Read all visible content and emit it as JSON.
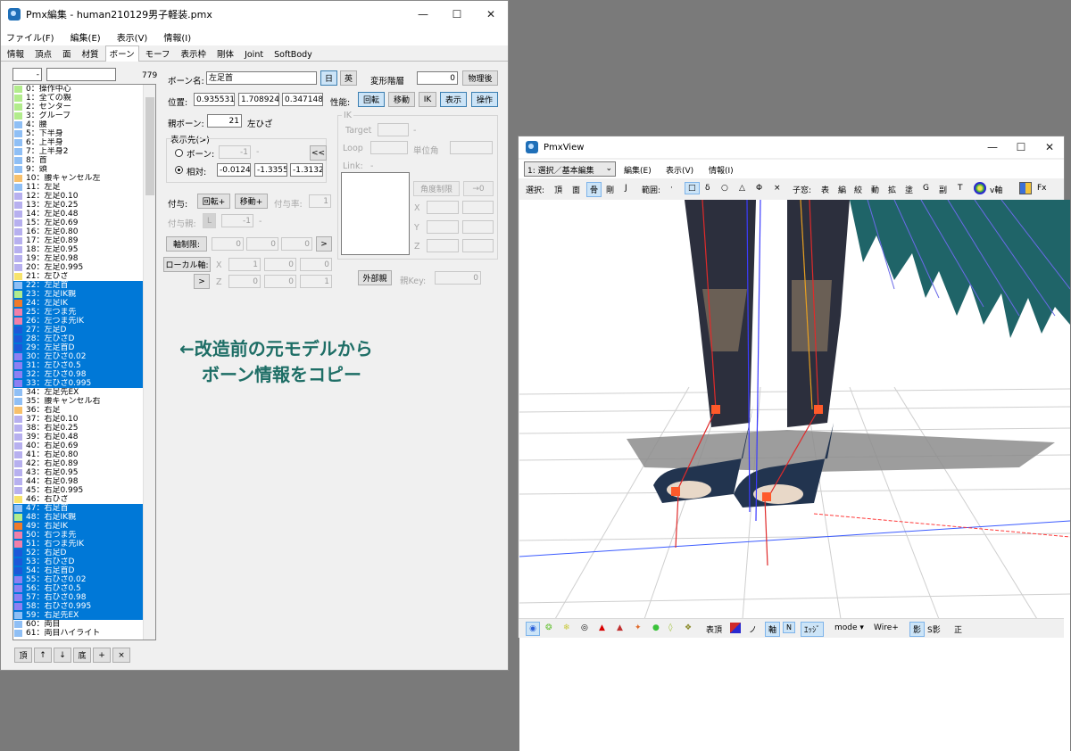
{
  "pmx_editor": {
    "title": "Pmx編集 - human210129男子軽装.pmx",
    "menu": [
      "ファイル(F)",
      "編集(E)",
      "表示(V)",
      "情報(I)"
    ],
    "tabs": [
      "情報",
      "頂点",
      "面",
      "材質",
      "ボーン",
      "モーフ",
      "表示枠",
      "剛体",
      "Joint",
      "SoftBody"
    ],
    "active_tab": "ボーン",
    "filter_value": "-",
    "bone_count": "779",
    "bone_name_label": "ボーン名:",
    "bone_name_value": "左足首",
    "lang_ja": "日",
    "lang_en": "英",
    "deform_label": "変形階層",
    "deform_value": "0",
    "after_physics": "物理後",
    "position_label": "位置:",
    "pos_x": "0.9355315",
    "pos_y": "1.708924",
    "pos_z": "0.3471485",
    "perf_label": "性能:",
    "rotate_btn": "回転",
    "move_btn": "移動",
    "ik_btn": "IK",
    "display_btn": "表示",
    "operate_btn": "操作",
    "parent_label": "親ボーン:",
    "parent_value": "21",
    "parent_name": "左ひざ",
    "dest_label": "表示先(>)",
    "radio_bone": "ボーン:",
    "radio_bone_value": "-1",
    "dash": "-",
    "radio_rel": "相対:",
    "rel_x": "-0.0124",
    "rel_y": "-1.3355",
    "rel_z": "-1.3132",
    "back_btn": "<<",
    "ik_group": "IK",
    "ik_target": "Target",
    "ik_loop": "Loop",
    "ik_unit_angle": "単位角",
    "ik_link": "Link:",
    "angle_limit": "角度制限",
    "arrow_zero": "→0",
    "x": "X",
    "y": "Y",
    "z": "Z",
    "grant_label": "付与:",
    "grant_rot": "回転+",
    "grant_move": "移動+",
    "grant_rate_label": "付与率:",
    "grant_rate": "1",
    "grant_parent_label": "付与親:",
    "grant_parent_l": "L",
    "grant_parent_value": "-1",
    "axis_limit": "軸制限:",
    "axis_v1": "0",
    "axis_v2": "0",
    "axis_v3": "0",
    "local_axis": "ローカル軸:",
    "local_x1": "1",
    "local_x2": "0",
    "local_x3": "0",
    "local_z1": "0",
    "local_z2": "0",
    "local_z3": "1",
    "ext_parent": "外部親",
    "parent_key": "親Key:",
    "parent_key_value": "0",
    "bottom_buttons": [
      "頂",
      "↑",
      "↓",
      "底",
      "+",
      "×"
    ],
    "bones": [
      {
        "t": "0：操作中心",
        "c": "#b2ec8c",
        "s": false
      },
      {
        "t": "1：全ての親",
        "c": "#b2ec8c",
        "s": false
      },
      {
        "t": "2：センター",
        "c": "#b2ec8c",
        "s": false
      },
      {
        "t": "3：グルーブ",
        "c": "#b2ec8c",
        "s": false
      },
      {
        "t": "4：腰",
        "c": "#8fbff5",
        "s": false
      },
      {
        "t": "5：下半身",
        "c": "#8fbff5",
        "s": false
      },
      {
        "t": "6：上半身",
        "c": "#8fbff5",
        "s": false
      },
      {
        "t": "7：上半身2",
        "c": "#8fbff5",
        "s": false
      },
      {
        "t": "8：首",
        "c": "#8fbff5",
        "s": false
      },
      {
        "t": "9：頭",
        "c": "#8fbff5",
        "s": false
      },
      {
        "t": "10：腰キャンセル左",
        "c": "#f7c06b",
        "s": false
      },
      {
        "t": "11：左足",
        "c": "#8fbff5",
        "s": false
      },
      {
        "t": "12：左足0.10",
        "c": "#b7b0ef",
        "s": false
      },
      {
        "t": "13：左足0.25",
        "c": "#b7b0ef",
        "s": false
      },
      {
        "t": "14：左足0.48",
        "c": "#b7b0ef",
        "s": false
      },
      {
        "t": "15：左足0.69",
        "c": "#b7b0ef",
        "s": false
      },
      {
        "t": "16：左足0.80",
        "c": "#b7b0ef",
        "s": false
      },
      {
        "t": "17：左足0.89",
        "c": "#b7b0ef",
        "s": false
      },
      {
        "t": "18：左足0.95",
        "c": "#b7b0ef",
        "s": false
      },
      {
        "t": "19：左足0.98",
        "c": "#b7b0ef",
        "s": false
      },
      {
        "t": "20：左足0.995",
        "c": "#b7b0ef",
        "s": false
      },
      {
        "t": "21：左ひざ",
        "c": "#f7e36b",
        "s": false
      },
      {
        "t": "22：左足首",
        "c": "#8fbff5",
        "s": true
      },
      {
        "t": "23：左足IK親",
        "c": "#b2ec8c",
        "s": true
      },
      {
        "t": "24：左足IK",
        "c": "#f07a2a",
        "s": true
      },
      {
        "t": "25：左つま先",
        "c": "#f27fa8",
        "s": true
      },
      {
        "t": "26：左つま先IK",
        "c": "#f27fa8",
        "s": true
      },
      {
        "t": "27：左足D",
        "c": "#1e58d8",
        "s": true
      },
      {
        "t": "28：左ひざD",
        "c": "#1e58d8",
        "s": true
      },
      {
        "t": "29：左足首D",
        "c": "#1e58d8",
        "s": true
      },
      {
        "t": "30：左ひざ0.02",
        "c": "#8d7ff2",
        "s": true
      },
      {
        "t": "31：左ひざ0.5",
        "c": "#8d7ff2",
        "s": true
      },
      {
        "t": "32：左ひざ0.98",
        "c": "#8d7ff2",
        "s": true
      },
      {
        "t": "33：左ひざ0.995",
        "c": "#8d7ff2",
        "s": true
      },
      {
        "t": "34：左足先EX",
        "c": "#8fbff5",
        "s": false
      },
      {
        "t": "35：腰キャンセル右",
        "c": "#8fbff5",
        "s": false
      },
      {
        "t": "36：右足",
        "c": "#f7c06b",
        "s": false
      },
      {
        "t": "37：右足0.10",
        "c": "#b7b0ef",
        "s": false
      },
      {
        "t": "38：右足0.25",
        "c": "#b7b0ef",
        "s": false
      },
      {
        "t": "39：右足0.48",
        "c": "#b7b0ef",
        "s": false
      },
      {
        "t": "40：右足0.69",
        "c": "#b7b0ef",
        "s": false
      },
      {
        "t": "41：右足0.80",
        "c": "#b7b0ef",
        "s": false
      },
      {
        "t": "42：右足0.89",
        "c": "#b7b0ef",
        "s": false
      },
      {
        "t": "43：右足0.95",
        "c": "#b7b0ef",
        "s": false
      },
      {
        "t": "44：右足0.98",
        "c": "#b7b0ef",
        "s": false
      },
      {
        "t": "45：右足0.995",
        "c": "#b7b0ef",
        "s": false
      },
      {
        "t": "46：右ひざ",
        "c": "#f7e36b",
        "s": false
      },
      {
        "t": "47：右足首",
        "c": "#8fbff5",
        "s": true
      },
      {
        "t": "48：右足IK親",
        "c": "#b2ec8c",
        "s": true
      },
      {
        "t": "49：右足IK",
        "c": "#f07a2a",
        "s": true
      },
      {
        "t": "50：右つま先",
        "c": "#f27fa8",
        "s": true
      },
      {
        "t": "51：右つま先IK",
        "c": "#f27fa8",
        "s": true
      },
      {
        "t": "52：右足D",
        "c": "#1e58d8",
        "s": true
      },
      {
        "t": "53：右ひざD",
        "c": "#1e58d8",
        "s": true
      },
      {
        "t": "54：右足首D",
        "c": "#1e58d8",
        "s": true
      },
      {
        "t": "55：右ひざ0.02",
        "c": "#8d7ff2",
        "s": true
      },
      {
        "t": "56：右ひざ0.5",
        "c": "#8d7ff2",
        "s": true
      },
      {
        "t": "57：右ひざ0.98",
        "c": "#8d7ff2",
        "s": true
      },
      {
        "t": "58：右ひざ0.995",
        "c": "#8d7ff2",
        "s": true
      },
      {
        "t": "59：右足先EX",
        "c": "#8fbff5",
        "s": true
      },
      {
        "t": "60：両目",
        "c": "#8fbff5",
        "s": false
      },
      {
        "t": "61：両目ハイライト",
        "c": "#8fbff5",
        "s": false
      }
    ]
  },
  "annotation": {
    "line1": "←改造前の元モデルから",
    "line2": "ボーン情報をコピー"
  },
  "pmx_view": {
    "title": "PmxView",
    "mode_select": "1: 選択／基本編集",
    "menu": [
      "編集(E)",
      "表示(V)",
      "情報(I)"
    ],
    "toolbar": {
      "select_label": "選択:",
      "select_items": [
        "頂",
        "面",
        "骨",
        "剛",
        "J"
      ],
      "range_label": "範囲:",
      "range_items": [
        "·",
        "□",
        "δ",
        "○",
        "△",
        "Φ",
        "×"
      ],
      "child_label": "子窓:",
      "child_items": [
        "表",
        "編",
        "絞",
        "動",
        "拡",
        "塗",
        "G",
        "副",
        "T"
      ],
      "vaxis": "v軸",
      "fx": "Fx"
    },
    "bottom": {
      "table_top": "表頂",
      "no": "ノ",
      "axis": "軸",
      "edge": "ｴｯｼﾞ",
      "mode": "mode ▾",
      "wire": "Wire+",
      "shadow": "影",
      "sshadow": "S影",
      "front": "正"
    }
  }
}
